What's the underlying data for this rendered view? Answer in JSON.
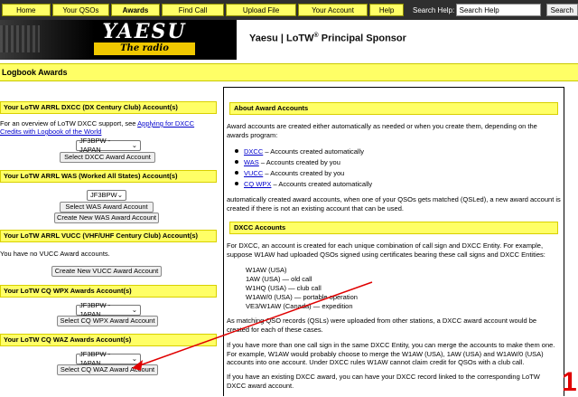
{
  "nav": {
    "items": [
      {
        "label": "Home"
      },
      {
        "label": "Your QSOs"
      },
      {
        "label": "Awards"
      },
      {
        "label": "Find Call"
      },
      {
        "label": "Upload File"
      },
      {
        "label": "Your Account"
      },
      {
        "label": "Help"
      }
    ],
    "search_label": "Search Help:",
    "search_value": "Search Help",
    "search_button": "Search"
  },
  "header": {
    "logo_word": "YAESU",
    "logo_tag": "The radio",
    "sponsor_prefix": "Yaesu | LoTW",
    "sponsor_sup": "®",
    "sponsor_suffix": " Principal Sponsor"
  },
  "page_title": "Logbook Awards",
  "left": {
    "dxcc": {
      "heading": "Your LoTW ARRL DXCC (DX Century Club) Account(s)",
      "intro": "For an overview of LoTW DXCC support, see ",
      "link": "Applying for DXCC Credits with Logbook of the World",
      "select_value": "JF3BPW - JAPAN",
      "button": "Select DXCC Award Account"
    },
    "was": {
      "heading": "Your LoTW ARRL WAS (Worked All States) Account(s)",
      "select_value": "JF3BPW",
      "select_button": "Select WAS Award Account",
      "create_button": "Create New WAS Award Account"
    },
    "vucc": {
      "heading": "Your LoTW ARRL VUCC (VHF/UHF Century Club) Account(s)",
      "note": "You have no VUCC Award accounts.",
      "create_button": "Create New VUCC Award Account"
    },
    "wpx": {
      "heading": "Your LoTW CQ WPX Awards Account(s)",
      "select_value": "JF3BPW - JAPAN",
      "button": "Select CQ WPX Award Account"
    },
    "waz": {
      "heading": "Your LoTW CQ WAZ Awards Account(s)",
      "select_value": "JF3BPW - JAPAN",
      "button": "Select CQ WAZ Award Account"
    }
  },
  "right": {
    "about_heading": "About Award Accounts",
    "about_intro": "Award accounts are created either automatically as needed or when you create them, depending on the awards program:",
    "bullets": [
      {
        "link": "DXCC",
        "text": " – Accounts created automatically"
      },
      {
        "link": "WAS",
        "text": " – Accounts created by you"
      },
      {
        "link": "VUCC",
        "text": " – Accounts created by you"
      },
      {
        "link": "CQ WPX",
        "text": " – Accounts created automatically"
      }
    ],
    "auto_text": "automatically created award accounts, when one of your QSOs gets matched (QSLed), a new award account is created if there is not an existing account that can be used.",
    "dxcc_heading": "DXCC Accounts",
    "dxcc_p1": "For DXCC, an account is created for each unique combination of call sign and DXCC Entity. For example, suppose W1AW had uploaded QSOs signed using certificates bearing these call signs and DXCC Entities:",
    "examples": [
      "W1AW (USA)",
      "1AW (USA) — old call",
      "W1HQ (USA) — club call",
      "W1AW/0 (USA) — portable operation",
      "VE3/W1AW (Canada) — expedition"
    ],
    "dxcc_p2": "As matching QSO records (QSLs) were uploaded from other stations, a DXCC award account would be created for each of these cases.",
    "dxcc_p3": "If you have more than one call sign in the same DXCC Entity, you can merge the accounts to make them one. For example, W1AW would probably choose to merge the W1AW (USA), 1AW (USA) and W1AW/0 (USA) accounts into one account. Under DXCC rules W1AW cannot claim credit for QSOs with a club call.",
    "dxcc_p4": "If you have an existing DXCC award, you can have your DXCC record linked to the corresponding LoTW DXCC award account."
  },
  "annotation_mark": "1",
  "colors": {
    "nav_bar": "#2f2f2f",
    "accent_yellow": "#ffff66",
    "annotation_red": "#e00000",
    "link_blue": "#0000cc"
  }
}
